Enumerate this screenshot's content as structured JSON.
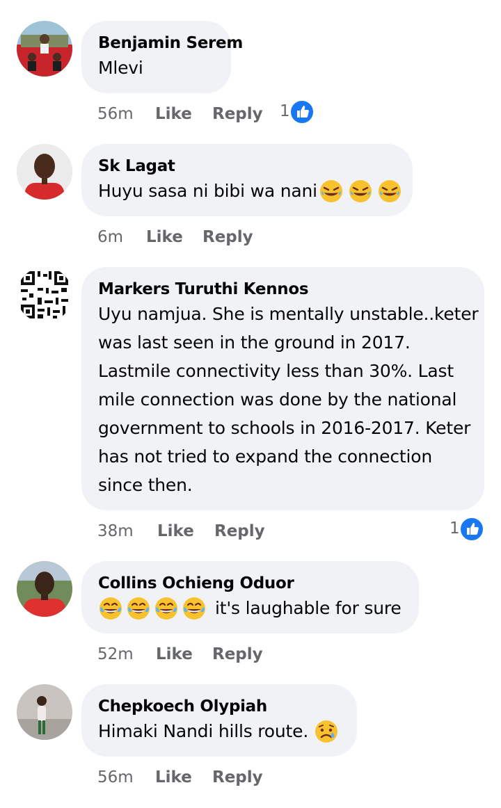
{
  "comments": [
    {
      "author": "Benjamin Serem",
      "text": "Mlevi",
      "time": "56m",
      "like_label": "Like",
      "reply_label": "Reply",
      "reaction_count": "1",
      "avatar": "profile-photo"
    },
    {
      "author": "Sk Lagat",
      "text": "Huyu sasa ni bibi wa nani",
      "emoji": "rolling-on-floor-laughing-emoji x3",
      "time": "6m",
      "like_label": "Like",
      "reply_label": "Reply",
      "avatar": "profile-photo"
    },
    {
      "author": "Markers Turuthi Kennos",
      "text": "Uyu namjua. She is mentally unstable..keter was last seen in the ground in 2017. Lastmile connectivity less than 30%. Last mile connection was done by the national government to schools in 2016-2017. Keter has not tried to expand the connection since then.",
      "lines": [
        "Uyu namjua. She is mentally unstable..keter",
        "was last seen in the ground in 2017.",
        "Lastmile connectivity less than 30%. Last",
        "mile connection was done by the national",
        "government to schools in 2016-2017. Keter",
        "has not tried to expand the connection",
        "since then."
      ],
      "time": "38m",
      "like_label": "Like",
      "reply_label": "Reply",
      "reaction_count": "1",
      "avatar": "qr-code-image"
    },
    {
      "author": "Collins Ochieng Oduor",
      "text": "it's laughable for sure",
      "emoji": "face-with-tears-of-joy-emoji x4",
      "time": "52m",
      "like_label": "Like",
      "reply_label": "Reply",
      "avatar": "profile-photo"
    },
    {
      "author": "Chepkoech Olypiah",
      "text": "Himaki Nandi hills route.",
      "emoji": "crying-face-emoji",
      "time": "56m",
      "like_label": "Like",
      "reply_label": "Reply",
      "avatar": "profile-photo"
    }
  ],
  "colors": {
    "bubble": "#f0f2f5",
    "secondary_text": "#65676b",
    "like_blue": "#1877f2",
    "emoji_yellow": "#f7c22d"
  }
}
